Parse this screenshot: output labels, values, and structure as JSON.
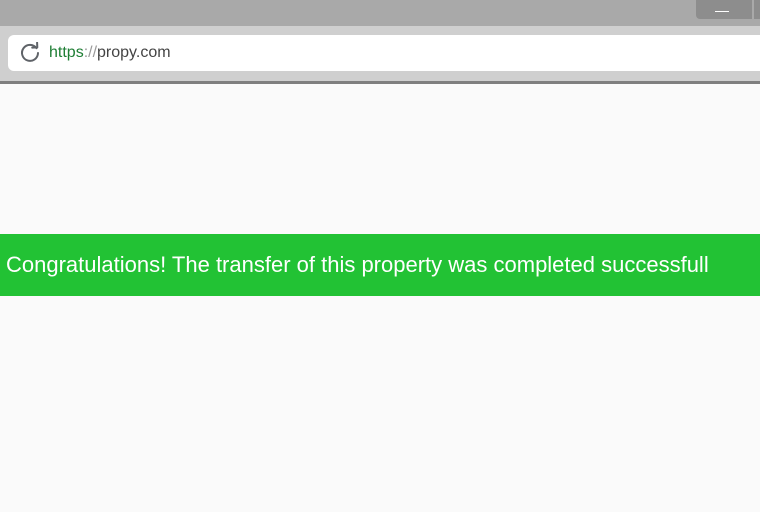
{
  "browser": {
    "minimize_glyph": "minimize-icon",
    "reload_icon": "reload-icon",
    "url": {
      "scheme": "https",
      "separator": "://",
      "host": "propy.com"
    }
  },
  "page": {
    "banner_message": "Congratulations! The transfer of this property was completed successfull",
    "banner_color": "#22c234",
    "background_color": "#fafafa"
  }
}
